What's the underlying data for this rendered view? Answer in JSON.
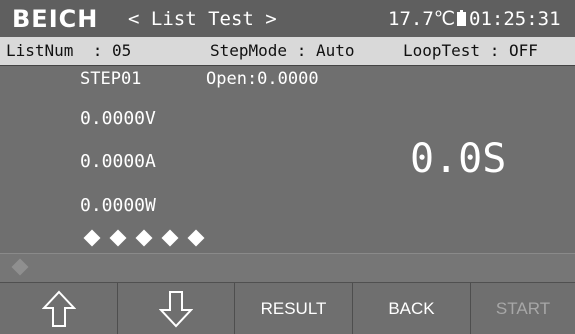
{
  "header": {
    "brand": "BEICH",
    "title": "< List Test >",
    "temperature": "17.7℃",
    "time": "01:25:31",
    "battery_icon": "battery-icon"
  },
  "info": {
    "listnum": "ListNum  : 05",
    "stepmode": "StepMode : Auto",
    "looptest": "LoopTest : OFF"
  },
  "main": {
    "step": "STEP01",
    "open": "Open:0.0000",
    "voltage": "0.0000V",
    "current": "0.0000A",
    "power": "0.0000W",
    "timer": "0.0S",
    "progress_indicator_count": 5
  },
  "status": {
    "icon": "info-icon"
  },
  "softkeys": {
    "up_icon": "arrow-up-icon",
    "down_icon": "arrow-down-icon",
    "result": "RESULT",
    "back": "BACK",
    "start": "START"
  }
}
